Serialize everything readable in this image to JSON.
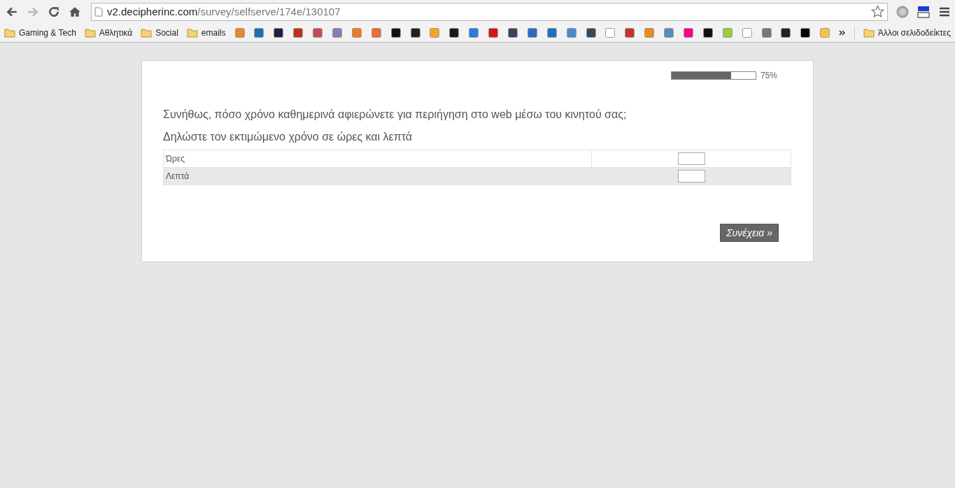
{
  "browser": {
    "url_host": "v2.decipherinc.com",
    "url_path": "/survey/selfserve/174e/130107"
  },
  "bookmarks": [
    {
      "kind": "folder",
      "label": "Gaming & Tech"
    },
    {
      "kind": "folder",
      "label": "Αθλητικά"
    },
    {
      "kind": "folder",
      "label": "Social"
    },
    {
      "kind": "folder",
      "label": "emails"
    },
    {
      "kind": "favicon",
      "color": "#e8892a"
    },
    {
      "kind": "favicon",
      "color": "#1a6fb5"
    },
    {
      "kind": "favicon",
      "color": "#1c2340"
    },
    {
      "kind": "favicon",
      "color": "#c0301e"
    },
    {
      "kind": "favicon",
      "color": "#c9475a"
    },
    {
      "kind": "favicon",
      "color": "#8a7ab8"
    },
    {
      "kind": "favicon",
      "color": "#f07a22"
    },
    {
      "kind": "favicon",
      "color": "#ee6a3a"
    },
    {
      "kind": "favicon",
      "color": "#111111"
    },
    {
      "kind": "favicon",
      "color": "#222222"
    },
    {
      "kind": "favicon",
      "color": "#f5a623"
    },
    {
      "kind": "favicon",
      "color": "#1a1a1a"
    },
    {
      "kind": "favicon",
      "color": "#2a7be0"
    },
    {
      "kind": "favicon",
      "color": "#d4141c"
    },
    {
      "kind": "favicon",
      "color": "#35465c"
    },
    {
      "kind": "favicon",
      "color": "#2a6bc4"
    },
    {
      "kind": "favicon",
      "color": "#1f6fc0"
    },
    {
      "kind": "favicon",
      "color": "#4a8ad0"
    },
    {
      "kind": "favicon",
      "color": "#34495e"
    },
    {
      "kind": "favicon",
      "color": "#ffffff"
    },
    {
      "kind": "favicon",
      "color": "#c4302b"
    },
    {
      "kind": "favicon",
      "color": "#e88b1a"
    },
    {
      "kind": "favicon",
      "color": "#5a8ab8"
    },
    {
      "kind": "favicon",
      "color": "#ff0084"
    },
    {
      "kind": "favicon",
      "color": "#111111"
    },
    {
      "kind": "favicon",
      "color": "#9ccc3a"
    },
    {
      "kind": "favicon",
      "color": "#ffffff"
    },
    {
      "kind": "favicon",
      "color": "#777777"
    },
    {
      "kind": "favicon",
      "color": "#222222"
    },
    {
      "kind": "favicon",
      "color": "#000000"
    },
    {
      "kind": "favicon",
      "color": "#f6c343"
    }
  ],
  "other_bookmarks": "Άλλοι σελιδοδείκτες",
  "progress": {
    "level": 0.71,
    "label": "75%"
  },
  "question": "Συνήθως, πόσο χρόνο καθημερινά αφιερώνετε για περιήγηση στο web μέσω του κινητού σας;",
  "instruction": "Δηλώστε τον εκτιμώμενο χρόνο σε ώρες και λεπτά",
  "rows": [
    {
      "label": "Ώρες"
    },
    {
      "label": "Λεπτά"
    }
  ],
  "continue_button": "Συνέχεια »"
}
